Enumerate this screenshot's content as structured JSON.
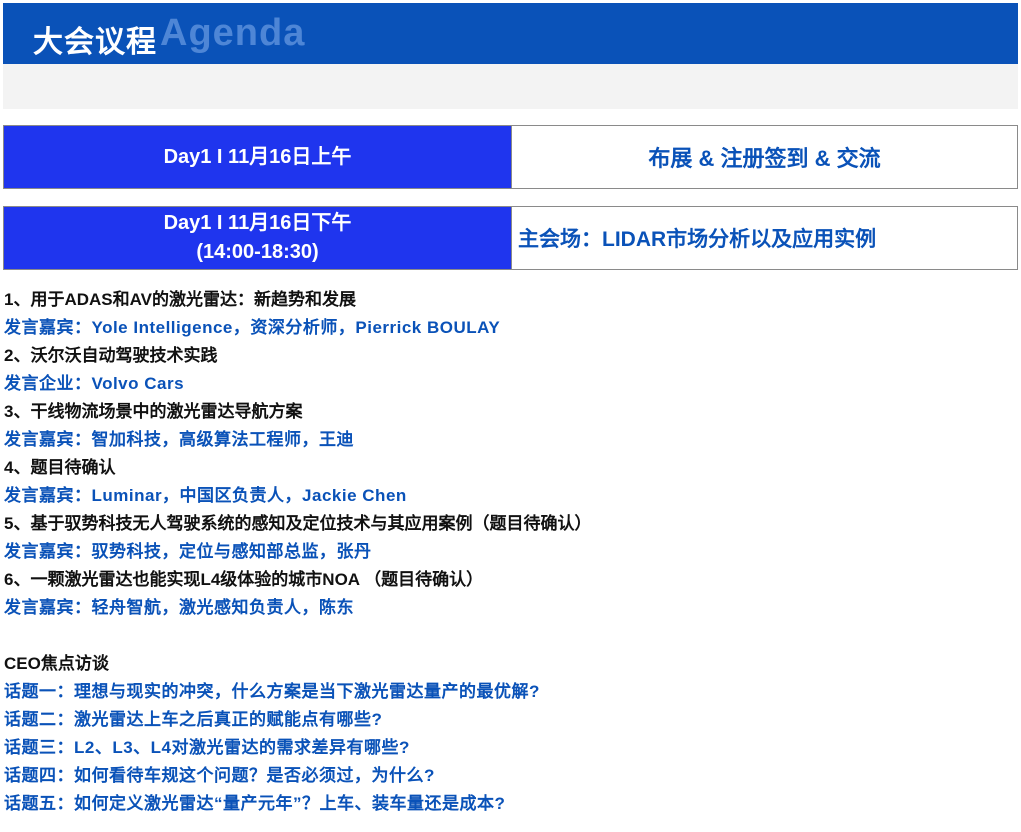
{
  "header": {
    "title_cn": "大会议程",
    "title_en": "Agenda"
  },
  "rows": [
    {
      "left": "Day1 I 11月16日上午",
      "right": "布展 & 注册签到 & 交流"
    },
    {
      "left": "Day1 I 11月16日下午",
      "left_sub": "(14:00-18:30)",
      "right": "主会场：LIDAR市场分析以及应用实例"
    }
  ],
  "agenda": [
    {
      "topic": "1、用于ADAS和AV的激光雷达：新趋势和发展",
      "speaker": "发言嘉宾：Yole Intelligence，资深分析师，Pierrick BOULAY"
    },
    {
      "topic": "2、沃尔沃自动驾驶技术实践",
      "speaker": "发言企业：Volvo Cars"
    },
    {
      "topic": "3、干线物流场景中的激光雷达导航方案",
      "speaker": "发言嘉宾：智加科技，高级算法工程师，王迪"
    },
    {
      "topic": "4、题目待确认",
      "speaker": "发言嘉宾：Luminar，中国区负责人，Jackie Chen"
    },
    {
      "topic": "5、基于驭势科技无人驾驶系统的感知及定位技术与其应用案例（题目待确认）",
      "speaker": "发言嘉宾：驭势科技，定位与感知部总监，张丹"
    },
    {
      "topic": "6、一颗激光雷达也能实现L4级体验的城市NOA （题目待确认）",
      "speaker": "发言嘉宾：轻舟智航，激光感知负责人，陈东"
    }
  ],
  "ceo": {
    "heading": "CEO焦点访谈",
    "topics": [
      "话题一：理想与现实的冲突，什么方案是当下激光雷达量产的最优解?",
      "话题二：激光雷达上车之后真正的赋能点有哪些?",
      "话题三：L2、L3、L4对激光雷达的需求差异有哪些?",
      "话题四：如何看待车规这个问题？是否必须过，为什么?",
      "话题五：如何定义激光雷达“量产元年”？上车、装车量还是成本?"
    ]
  },
  "colors": {
    "header_bg": "#0a52b8",
    "header_en_text": "#4e86d6",
    "day_cell_bg": "#1f35ee",
    "blue_text": "#0a52b8",
    "black_text": "#111111"
  }
}
